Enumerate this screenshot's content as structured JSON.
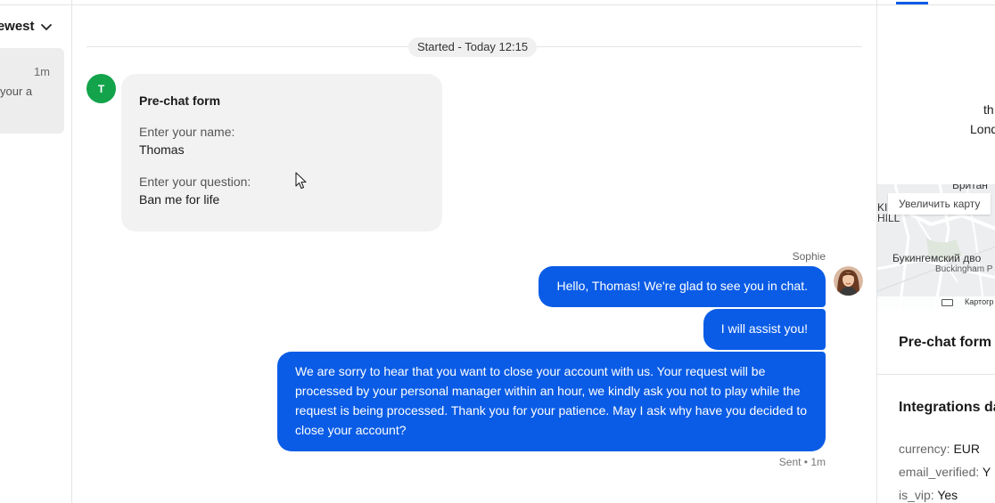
{
  "sidebar": {
    "sort_label": "Newest",
    "conversation": {
      "time": "1m",
      "snippet": "your a"
    }
  },
  "chat": {
    "started_label": "Started - Today 12:15",
    "visitor_initial": "T",
    "prechat": {
      "title": "Pre-chat form",
      "fields": [
        {
          "label": "Enter your name:",
          "value": "Thomas"
        },
        {
          "label": "Enter your question:",
          "value": "Ban me for life"
        }
      ]
    },
    "agent_name": "Sophie",
    "messages": [
      "Hello, Thomas! We're glad to see you in chat.",
      "I will assist you!",
      "We are sorry to hear that you want to close your account with us. Your request will be processed by your personal manager within an hour, we kindly ask you not to play while the request is being processed. Thank you for your patience. May I ask why have you decided to close your account?"
    ],
    "status": "Sent • 1m"
  },
  "details": {
    "location_line1": "th",
    "location_line2": "Lond",
    "map": {
      "enlarge_label": "Увеличить карту",
      "label_top": "Британ",
      "label_hill": "HILL",
      "label_ki": "KI",
      "label_palace": "Букингемский двo",
      "label_palace_en": "Buckingham P",
      "credit": "Картогр"
    },
    "prechat_heading": "Pre-chat form",
    "integrations_heading": "Integrations da",
    "integrations": [
      {
        "key": "currency:",
        "value": "EUR"
      },
      {
        "key": "email_verified:",
        "value": "Y"
      },
      {
        "key": "is_vip:",
        "value": "Yes"
      }
    ]
  },
  "colors": {
    "accent": "#0a5ce6",
    "visitor_avatar": "#13a34b",
    "bubble_gray": "#f2f2f2"
  }
}
